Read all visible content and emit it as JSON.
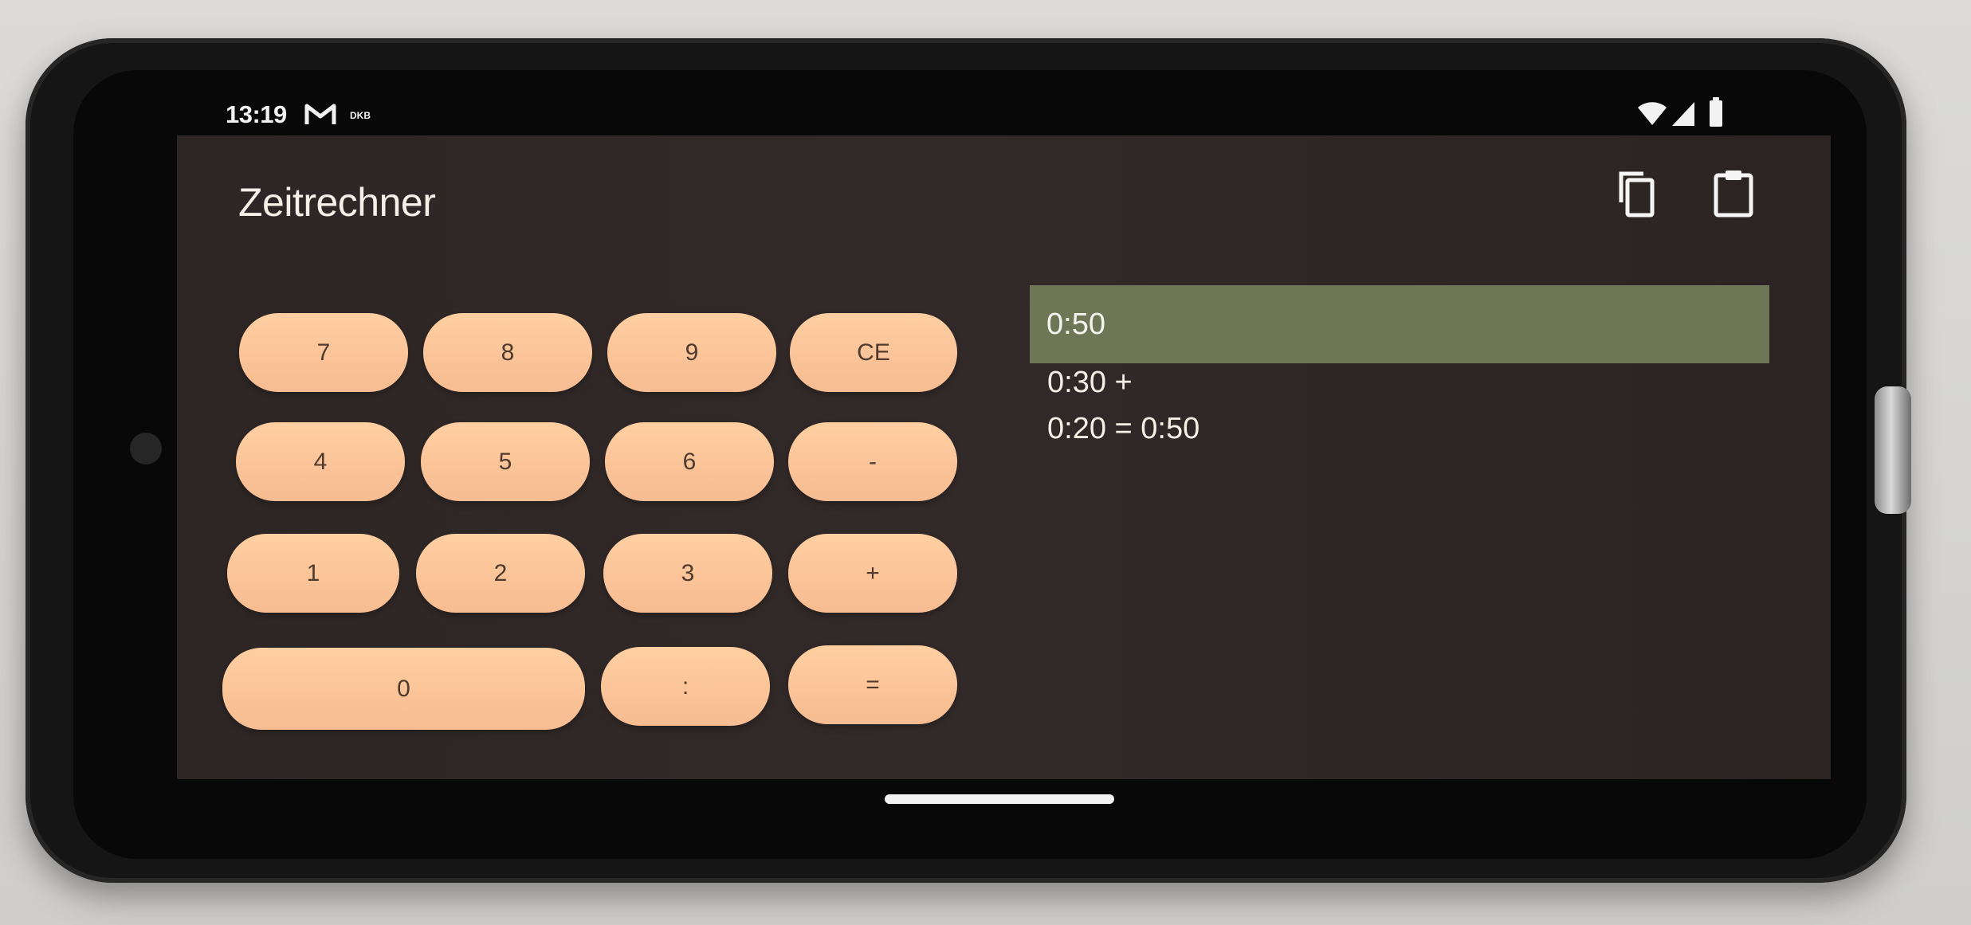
{
  "status_bar": {
    "time": "13:19",
    "notification_label": "DKB",
    "icons": [
      "gmail-icon",
      "wifi-icon",
      "signal-icon",
      "battery-icon"
    ]
  },
  "app": {
    "title": "Zeitrechner",
    "toolbar_icons": [
      "copy-icon",
      "paste-icon"
    ]
  },
  "keypad": {
    "rows": [
      [
        "7",
        "8",
        "9",
        "CE"
      ],
      [
        "4",
        "5",
        "6",
        "-"
      ],
      [
        "1",
        "2",
        "3",
        "+"
      ],
      [
        "0",
        ":",
        "="
      ]
    ]
  },
  "display": {
    "result": "0:50",
    "history": [
      "0:30 +",
      "0:20 = 0:50"
    ]
  },
  "colors": {
    "screen_background": "#2f2827",
    "key_background": "#f6bb91",
    "key_text": "#4f3a2d",
    "result_highlight": "#6f7655",
    "title_text": "#f5efe8"
  }
}
